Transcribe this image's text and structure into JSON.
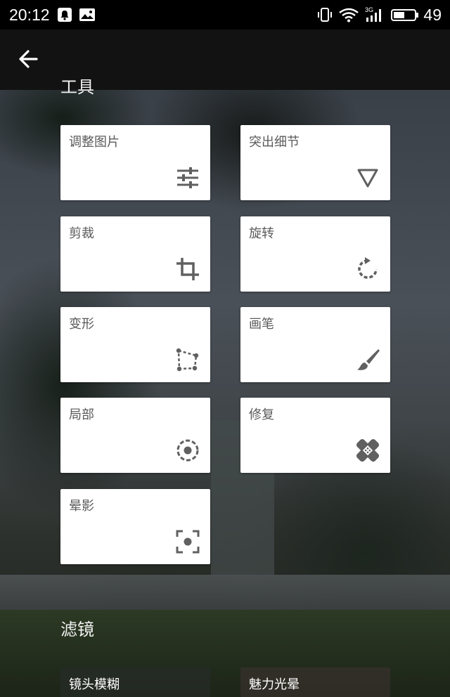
{
  "status_bar": {
    "time": "20:12",
    "network": "3G",
    "battery": "49"
  },
  "sections": {
    "tools_title": "工具",
    "filters_title": "滤镜"
  },
  "tools": [
    {
      "label": "调整图片",
      "icon": "tune-icon"
    },
    {
      "label": "突出细节",
      "icon": "details-triangle-icon"
    },
    {
      "label": "剪裁",
      "icon": "crop-icon"
    },
    {
      "label": "旋转",
      "icon": "rotate-icon"
    },
    {
      "label": "变形",
      "icon": "transform-icon"
    },
    {
      "label": "画笔",
      "icon": "brush-icon"
    },
    {
      "label": "局部",
      "icon": "selective-icon"
    },
    {
      "label": "修复",
      "icon": "healing-icon"
    },
    {
      "label": "晕影",
      "icon": "vignette-icon"
    }
  ],
  "filters": [
    {
      "label": "镜头模糊"
    },
    {
      "label": "魅力光晕"
    }
  ],
  "colors": {
    "tile_bg": "#ffffff",
    "icon_gray": "#606060",
    "bar_bg": "#000000"
  }
}
